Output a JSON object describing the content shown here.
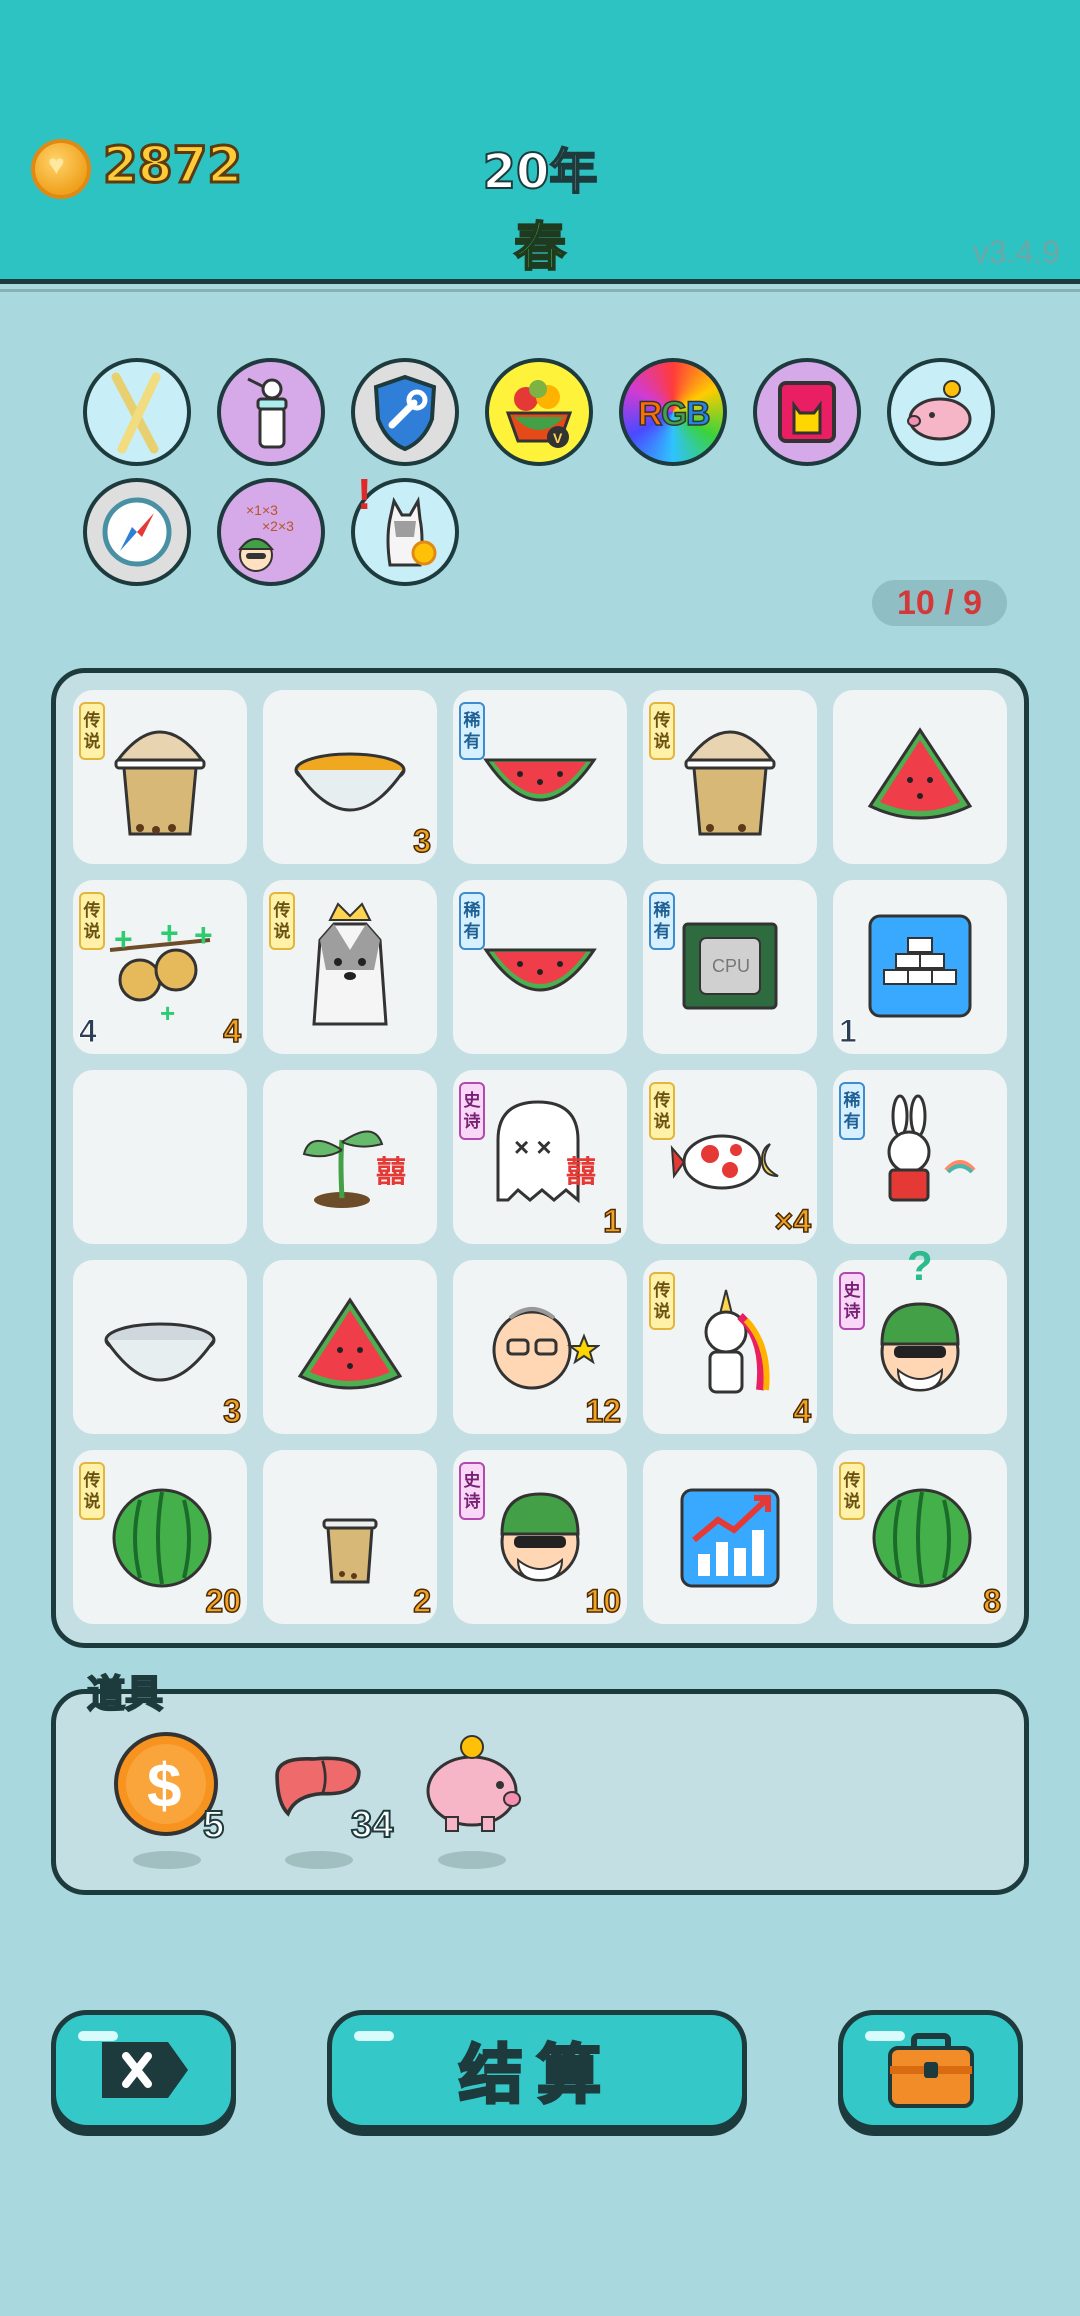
{
  "header": {
    "coins": "2872",
    "year": "20年",
    "season": "春",
    "version": "v3.4.9"
  },
  "skills": {
    "row1": [
      "chopsticks-icon",
      "baby-bottle-icon",
      "wrench-shield-icon",
      "fruit-basket-icon",
      "rgb-icon",
      "cat-frame-icon",
      "piggy-bank-icon"
    ],
    "row2": [
      "compass-icon",
      "math-head-icon",
      "dog-coin-icon"
    ],
    "alert": "!",
    "counter": "10 / 9"
  },
  "grid": {
    "cells": [
      {
        "tag": "传说",
        "item": "milk-tea-icon",
        "br": "",
        "bl": ""
      },
      {
        "tag": "",
        "item": "honey-bowl-icon",
        "br": "3",
        "bl": ""
      },
      {
        "tag": "稀有",
        "item": "watermelon-slice-icon",
        "br": "",
        "bl": ""
      },
      {
        "tag": "传说",
        "item": "milk-tea-icon",
        "br": "",
        "bl": ""
      },
      {
        "tag": "",
        "item": "watermelon-slice-icon",
        "br": "",
        "bl": ""
      },
      {
        "tag": "传说",
        "item": "clover-fruit-icon",
        "br": "4",
        "bl": "4"
      },
      {
        "tag": "传说",
        "item": "husky-king-icon",
        "br": "",
        "bl": ""
      },
      {
        "tag": "稀有",
        "item": "watermelon-slice-icon",
        "br": "",
        "bl": ""
      },
      {
        "tag": "稀有",
        "item": "cpu-chip-icon",
        "br": "",
        "bl": ""
      },
      {
        "tag": "",
        "item": "gold-bars-icon",
        "br": "",
        "bl": "1"
      },
      {
        "tag": "",
        "item": "",
        "br": "",
        "bl": ""
      },
      {
        "tag": "",
        "item": "sprout-icon",
        "br": "",
        "bl": ""
      },
      {
        "tag": "史诗",
        "item": "ghost-icon",
        "br": "1",
        "bl": ""
      },
      {
        "tag": "传说",
        "item": "koi-fish-icon",
        "br": "×4",
        "bl": ""
      },
      {
        "tag": "稀有",
        "item": "rabbit-icon",
        "br": "",
        "bl": ""
      },
      {
        "tag": "",
        "item": "empty-bowl-icon",
        "br": "3",
        "bl": ""
      },
      {
        "tag": "",
        "item": "watermelon-slice-icon",
        "br": "",
        "bl": ""
      },
      {
        "tag": "",
        "item": "old-man-icon",
        "br": "12",
        "bl": ""
      },
      {
        "tag": "传说",
        "item": "unicorn-icon",
        "br": "4",
        "bl": ""
      },
      {
        "tag": "史诗",
        "item": "green-hat-man-icon",
        "br": "",
        "bl": ""
      },
      {
        "tag": "传说",
        "item": "whole-watermelon-icon",
        "br": "20",
        "bl": ""
      },
      {
        "tag": "",
        "item": "small-tea-icon",
        "br": "2",
        "bl": ""
      },
      {
        "tag": "史诗",
        "item": "green-hat-man-icon",
        "br": "10",
        "bl": ""
      },
      {
        "tag": "",
        "item": "growth-chart-icon",
        "br": "",
        "bl": ""
      },
      {
        "tag": "传说",
        "item": "whole-watermelon-icon",
        "br": "8",
        "bl": ""
      }
    ],
    "qmark": "?",
    "happy_char": "囍"
  },
  "items": {
    "title": "道具",
    "list": [
      {
        "icon": "dollar-coin-icon",
        "count": "5"
      },
      {
        "icon": "liver-icon",
        "count": "34"
      },
      {
        "icon": "piggy-bank-icon",
        "count": ""
      }
    ]
  },
  "buttons": {
    "settle": "结算"
  },
  "colors": {
    "header": "#2dc3c3",
    "background": "#a9d8de",
    "accent": "#35c8c8",
    "outline": "#1d3a3d"
  }
}
